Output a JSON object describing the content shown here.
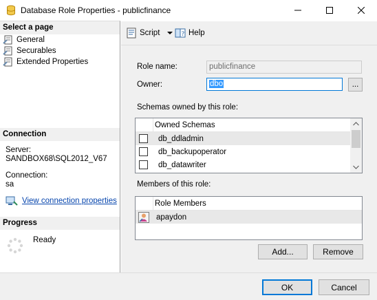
{
  "window": {
    "title": "Database Role Properties - publicfinance",
    "minimize_icon": "minimize-icon",
    "maximize_icon": "maximize-icon",
    "close_icon": "close-icon"
  },
  "left_pane": {
    "select_page_header": "Select a page",
    "pages": [
      {
        "label": "General",
        "icon": "page-wrench-icon"
      },
      {
        "label": "Securables",
        "icon": "page-wrench-icon"
      },
      {
        "label": "Extended Properties",
        "icon": "page-wrench-icon"
      }
    ],
    "connection_header": "Connection",
    "server_label": "Server:",
    "server_value": "SANDBOX68\\SQL2012_V67",
    "connection_label": "Connection:",
    "connection_value": "sa",
    "view_connection_link": "View connection properties",
    "progress_header": "Progress",
    "progress_status": "Ready"
  },
  "toolbar": {
    "script_label": "Script",
    "help_label": "Help"
  },
  "form": {
    "role_name_label": "Role name:",
    "role_name_value": "publicfinance",
    "owner_label": "Owner:",
    "owner_value": "dbo",
    "browse_label": "...",
    "schemas_label": "Schemas owned by this role:",
    "schemas_header": "Owned Schemas",
    "schemas": [
      {
        "name": "db_ddladmin",
        "checked": false
      },
      {
        "name": "db_backupoperator",
        "checked": false
      },
      {
        "name": "db_datawriter",
        "checked": false
      }
    ],
    "members_label": "Members of this role:",
    "members_header": "Role Members",
    "members": [
      {
        "name": "apaydon",
        "icon": "user-icon"
      }
    ],
    "add_label": "Add...",
    "remove_label": "Remove"
  },
  "footer": {
    "ok_label": "OK",
    "cancel_label": "Cancel"
  },
  "colors": {
    "accent": "#0078d7",
    "selection": "#3399ff",
    "link": "#0645ad",
    "panel": "#f0f0f0"
  }
}
